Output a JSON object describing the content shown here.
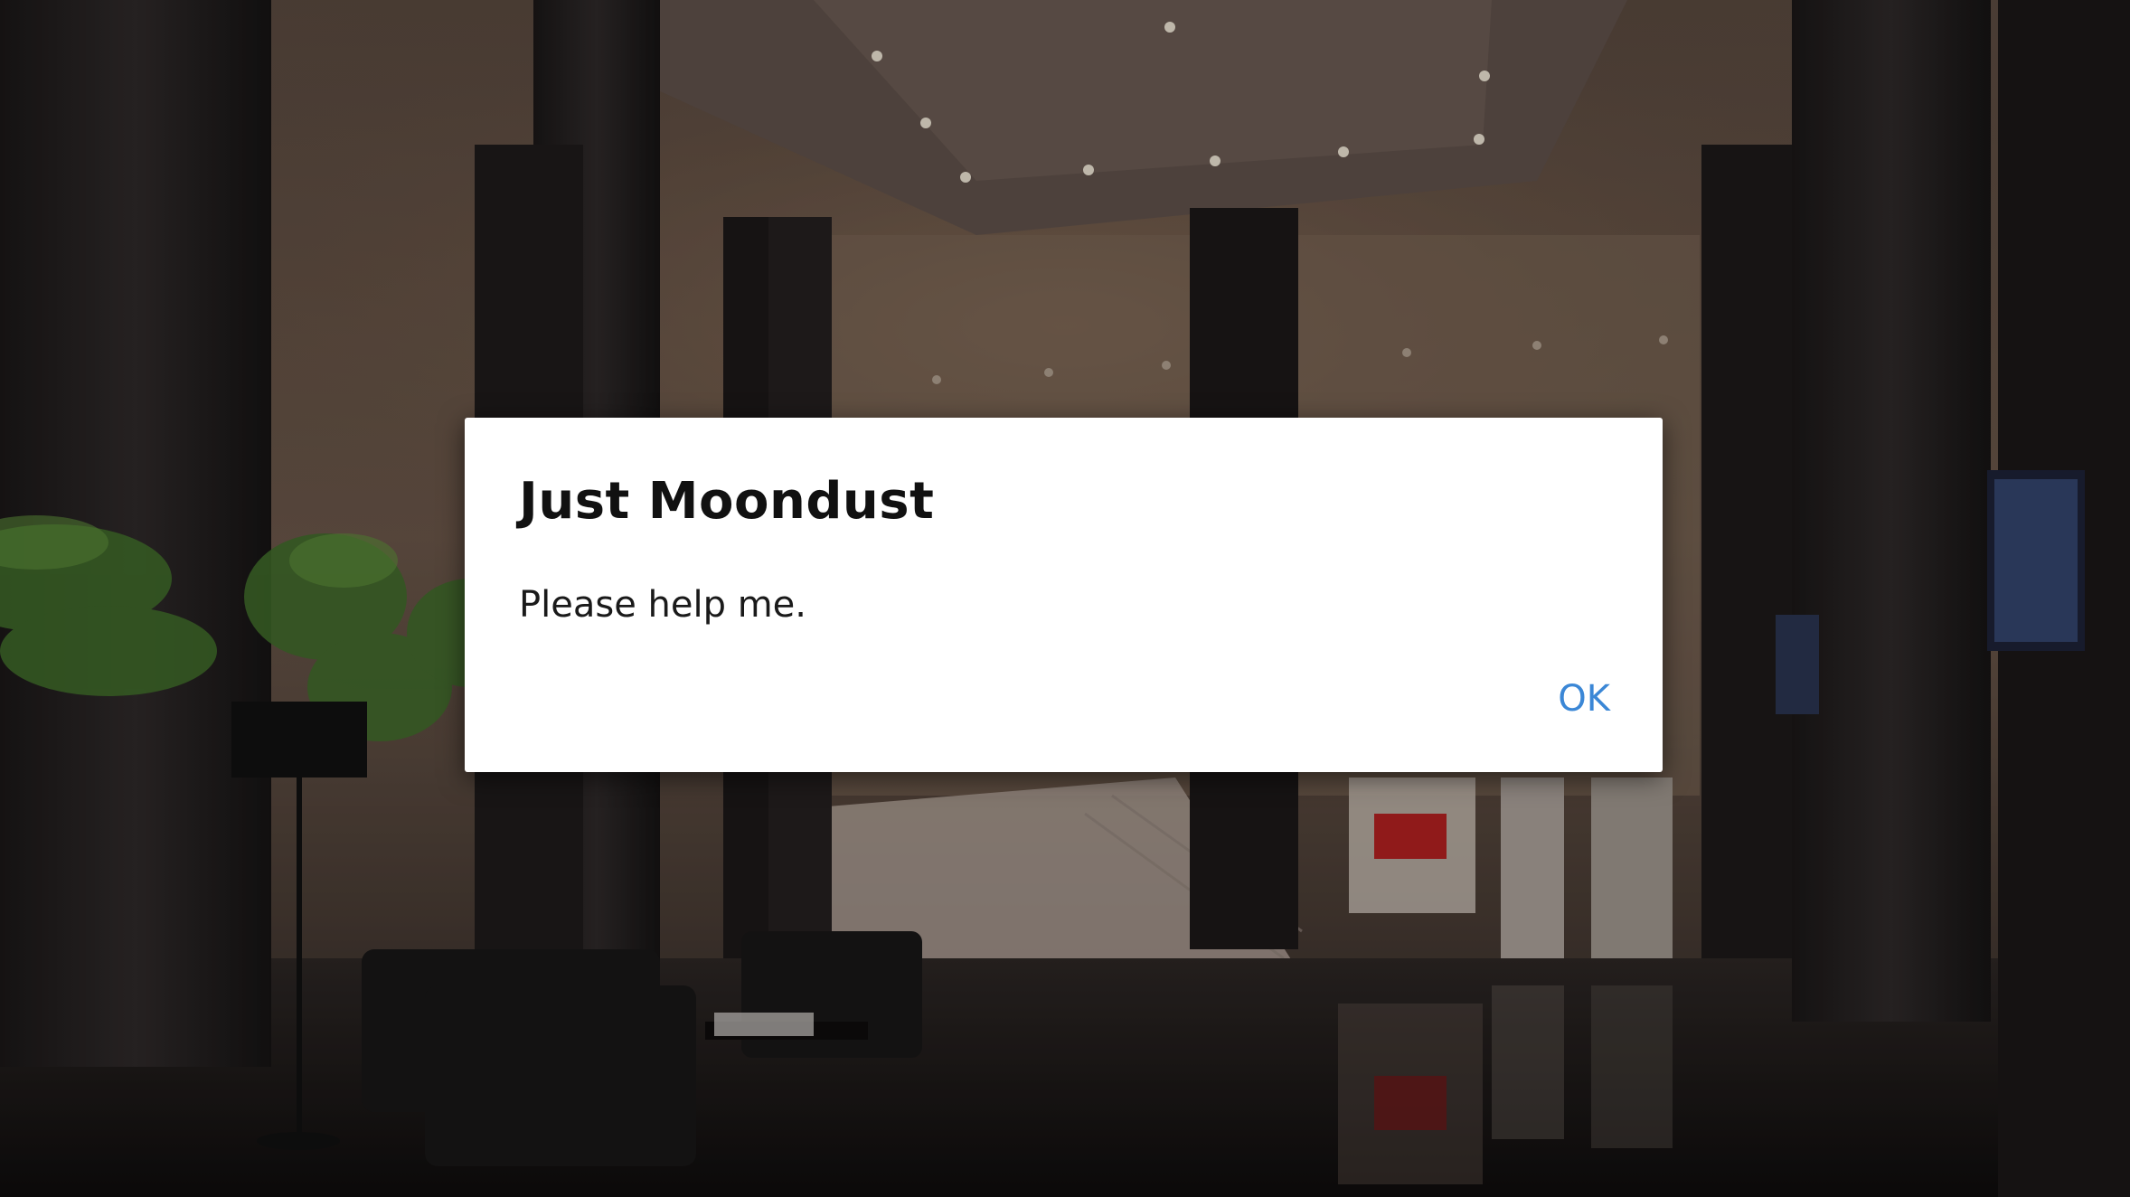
{
  "dialog": {
    "title": "Just Moondust",
    "message": "Please help me.",
    "ok_label": "OK"
  },
  "background": {
    "scene": "office-lobby-interior"
  },
  "colors": {
    "dialog_background": "#ffffff",
    "title_text": "#111111",
    "button_text": "#3b87d6"
  }
}
